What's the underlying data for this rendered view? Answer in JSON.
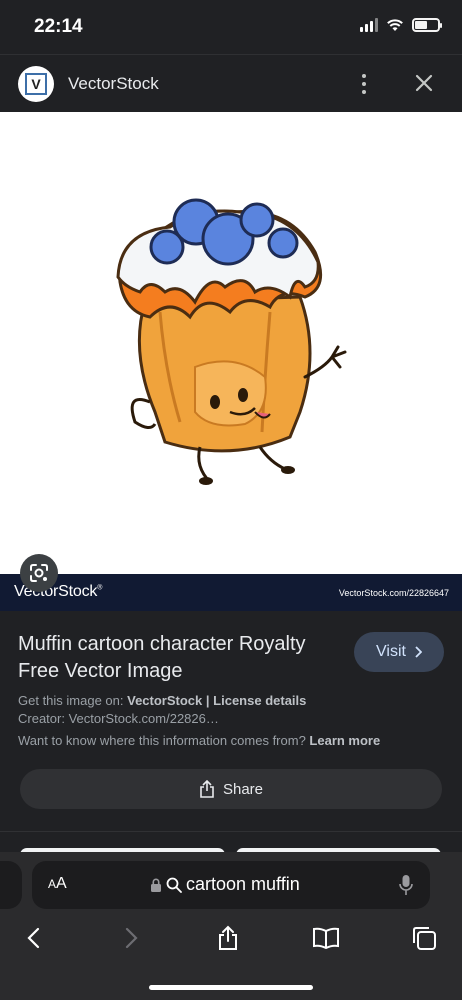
{
  "status_bar": {
    "time": "22:14"
  },
  "site_header": {
    "site_name": "VectorStock"
  },
  "image": {
    "watermark_logo": "VectorStock",
    "watermark_url": "VectorStock.com/22826647"
  },
  "info": {
    "title": "Muffin cartoon character Royalty Free Vector Image",
    "visit_label": "Visit",
    "get_image_prefix": "Get this image on:",
    "get_image_source": "VectorStock",
    "separator": "|",
    "license_link": "License details",
    "creator_line": "Creator: VectorStock.com/22826…",
    "info_question": "Want to know where this information comes from?",
    "learn_more": "Learn more",
    "share_label": "Share"
  },
  "browser": {
    "aa_label": "AA",
    "address_text": "cartoon muffin"
  },
  "colors": {
    "background": "#202124",
    "visit_button": "#394457",
    "watermark_bar": "#111a33"
  }
}
